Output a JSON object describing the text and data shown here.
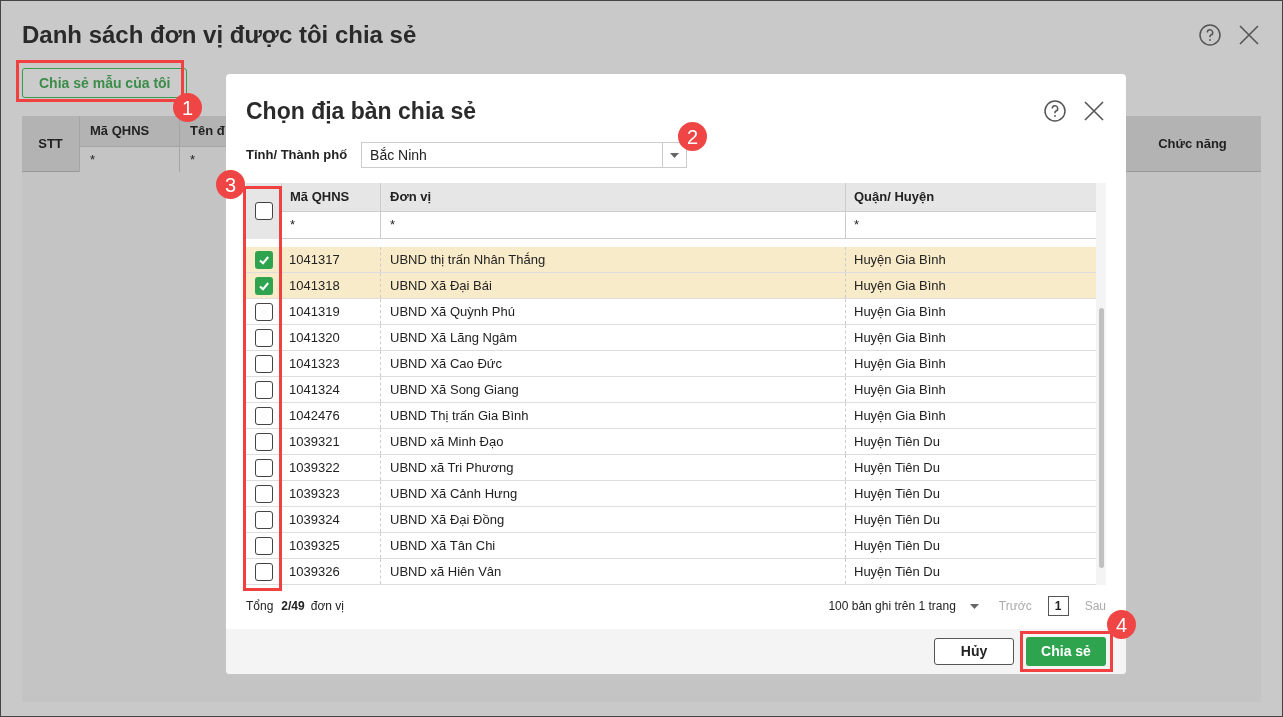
{
  "page": {
    "title": "Danh sách đơn vị được tôi chia sẻ",
    "share_button": "Chia sẻ mẫu của tôi",
    "table": {
      "columns": [
        "STT",
        "Mã QHNS",
        "Tên đ",
        "Chức năng"
      ],
      "filters": [
        "*",
        "*"
      ]
    }
  },
  "dialog": {
    "title": "Chọn địa bàn chia sẻ",
    "province": {
      "label": "Tỉnh/ Thành phố",
      "value": "Bắc Ninh"
    },
    "grid": {
      "select_all_checked": false,
      "columns": [
        "Mã QHNS",
        "Đơn vị",
        "Quận/ Huyện"
      ],
      "filters": [
        "*",
        "*",
        "*"
      ],
      "rows": [
        {
          "code": "1041317",
          "unit": "UBND thị trấn Nhân Thắng",
          "district": "Huyện Gia Bình",
          "checked": true
        },
        {
          "code": "1041318",
          "unit": "UBND Xã Đại Bái",
          "district": "Huyện Gia Bình",
          "checked": true
        },
        {
          "code": "1041319",
          "unit": "UBND Xã Quỳnh Phú",
          "district": "Huyện Gia Bình",
          "checked": false
        },
        {
          "code": "1041320",
          "unit": "UBND Xã Lãng Ngâm",
          "district": "Huyện Gia Bình",
          "checked": false
        },
        {
          "code": "1041323",
          "unit": "UBND Xã Cao Đức",
          "district": "Huyện Gia Bình",
          "checked": false
        },
        {
          "code": "1041324",
          "unit": "UBND Xã Song Giang",
          "district": "Huyện Gia Bình",
          "checked": false
        },
        {
          "code": "1042476",
          "unit": "UBND Thị trấn Gia Bình",
          "district": "Huyện Gia Bình",
          "checked": false
        },
        {
          "code": "1039321",
          "unit": "UBND xã Minh Đạo",
          "district": "Huyện Tiên Du",
          "checked": false
        },
        {
          "code": "1039322",
          "unit": "UBND xã Tri Phương",
          "district": "Huyện Tiên Du",
          "checked": false
        },
        {
          "code": "1039323",
          "unit": "UBND Xã Cảnh Hưng",
          "district": "Huyện Tiên Du",
          "checked": false
        },
        {
          "code": "1039324",
          "unit": "UBND Xã Đại Đồng",
          "district": "Huyện Tiên Du",
          "checked": false
        },
        {
          "code": "1039325",
          "unit": "UBND Xã Tân Chi",
          "district": "Huyện Tiên Du",
          "checked": false
        },
        {
          "code": "1039326",
          "unit": "UBND xã Hiên Vân",
          "district": "Huyện Tiên Du",
          "checked": false
        }
      ]
    },
    "footer": {
      "total_label": "Tổng",
      "total": "2/49",
      "unit": "đơn vị",
      "page_size": "100 bản ghi trên 1 trang",
      "prev": "Trước",
      "page": "1",
      "next": "Sau"
    },
    "buttons": {
      "cancel": "Hủy",
      "share": "Chia sẻ"
    }
  },
  "annotations": [
    "1",
    "2",
    "3",
    "4"
  ]
}
